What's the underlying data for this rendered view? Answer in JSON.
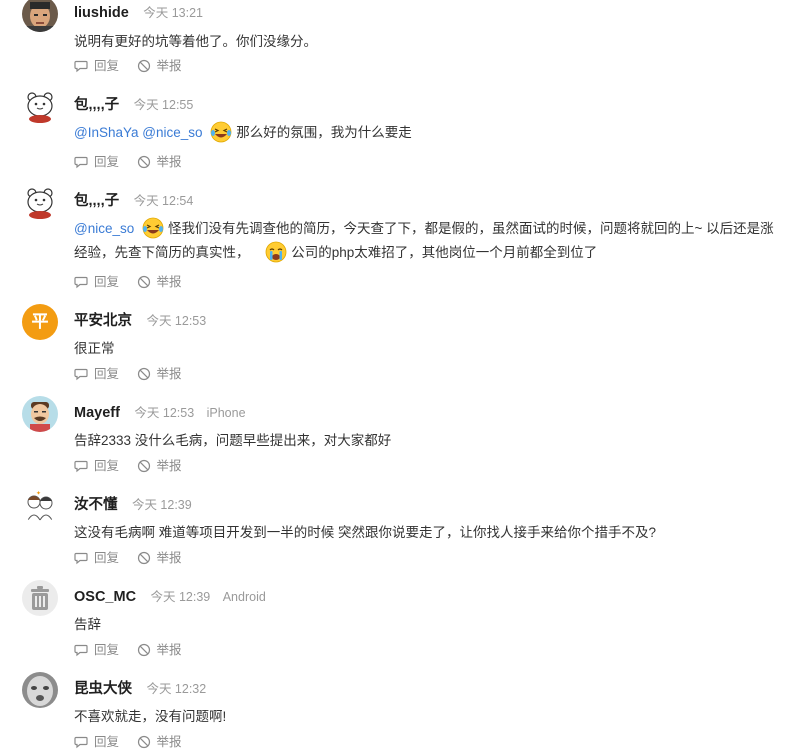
{
  "labels": {
    "reply": "回复",
    "report": "举报"
  },
  "comments": [
    {
      "user": "liushide",
      "time": "今天 13:21",
      "device": "",
      "avatar": "photo-avatar",
      "content": "说明有更好的坑等着他了。你们没缘分。"
    },
    {
      "user": "包,,,,子",
      "time": "今天 12:55",
      "device": "",
      "avatar": "cartoon-bun-avatar",
      "mentions": [
        "@InShaYa",
        "@nice_so"
      ],
      "emoji": "laughing-crying-emoji",
      "content": "那么好的氛围，我为什么要走"
    },
    {
      "user": "包,,,,子",
      "time": "今天 12:54",
      "device": "",
      "avatar": "cartoon-bun-avatar",
      "mention": "@nice_so",
      "emoji1": "laughing-crying-emoji",
      "content_part1": "怪我们没有先调查他的简历，今天查了下，都是假的，虽然面试的时候，问题将就回的上~ 以后还是涨经验，先查下简历的真实性，",
      "emoji2": "crying-emoji",
      "content_part2": "公司的php太难招了，其他岗位一个月前都全到位了"
    },
    {
      "user": "平安北京",
      "time": "今天 12:53",
      "device": "",
      "avatar": "letter-avatar",
      "avatar_letter": "平",
      "avatar_color": "#f39c12",
      "content": "很正常"
    },
    {
      "user": "Mayeff",
      "time": "今天 12:53",
      "device": "iPhone",
      "avatar": "cartoon-man-avatar",
      "content": "告辞2333 没什么毛病，问题早些提出来，对大家都好"
    },
    {
      "user": "汝不懂",
      "time": "今天 12:39",
      "device": "",
      "avatar": "sketch-couple-avatar",
      "content": "这没有毛病啊 难道等项目开发到一半的时候 突然跟你说要走了，让你找人接手来给你个措手不及?"
    },
    {
      "user": "OSC_MC",
      "time": "今天 12:39",
      "device": "Android",
      "avatar": "trash-can-avatar",
      "content": "告辞"
    },
    {
      "user": "昆虫大侠",
      "time": "今天 12:32",
      "device": "",
      "avatar": "face-photo-avatar",
      "content": "不喜欢就走，没有问题啊!"
    }
  ],
  "colors": {
    "mention": "#3a7bd5",
    "meta": "#9a9a9a",
    "text": "#333333"
  }
}
